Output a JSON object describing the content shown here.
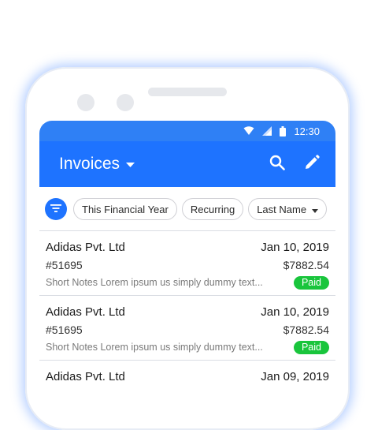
{
  "status_bar": {
    "time": "12:30"
  },
  "app_bar": {
    "title": "Invoices"
  },
  "filters": {
    "chips": [
      {
        "label": "This Financial Year"
      },
      {
        "label": "Recurring"
      },
      {
        "label": "Last Name"
      }
    ]
  },
  "invoices": [
    {
      "company": "Adidas Pvt. Ltd",
      "date": "Jan 10, 2019",
      "number": "#51695",
      "amount": "$7882.54",
      "notes": "Short Notes Lorem ipsum us simply dummy text...",
      "status": "Paid"
    },
    {
      "company": "Adidas Pvt. Ltd",
      "date": "Jan 10, 2019",
      "number": "#51695",
      "amount": "$7882.54",
      "notes": "Short Notes Lorem ipsum us simply dummy text...",
      "status": "Paid"
    },
    {
      "company": "Adidas Pvt. Ltd",
      "date": "Jan 09, 2019",
      "number": "",
      "amount": "",
      "notes": "",
      "status": ""
    }
  ],
  "colors": {
    "accent": "#1e73ff",
    "status_bar": "#2f80f5",
    "paid": "#19c53c"
  },
  "icons": [
    "wifi-icon",
    "signal-icon",
    "battery-icon",
    "caret-down-icon",
    "search-icon",
    "edit-icon",
    "filter-icon"
  ]
}
